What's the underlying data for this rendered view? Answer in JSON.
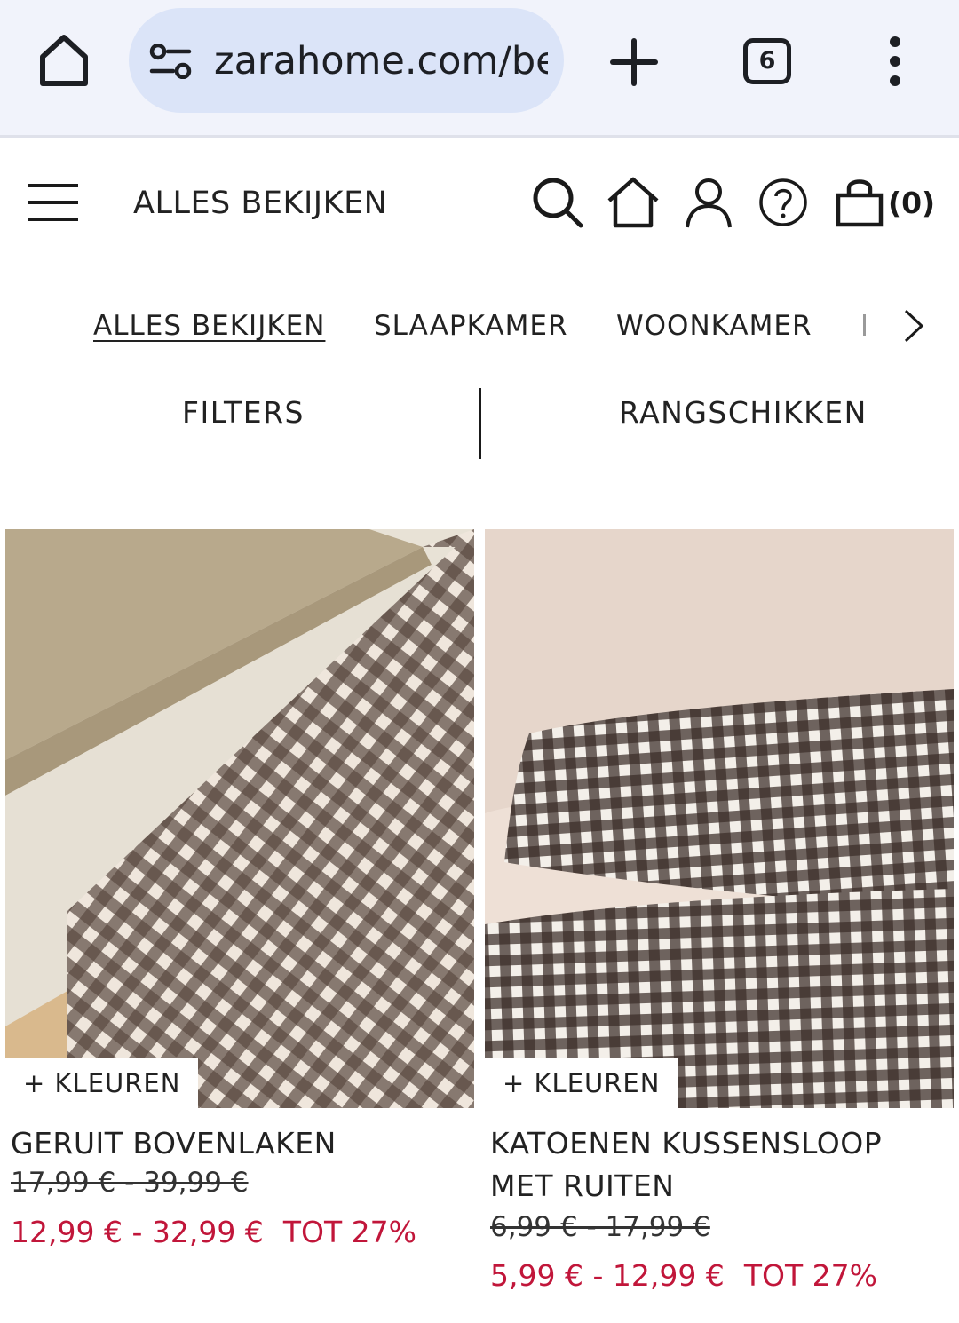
{
  "browser": {
    "url": "zarahome.com/be",
    "tab_count": "6"
  },
  "header": {
    "title": "ALLES BEKIJKEN",
    "cart_count": "(0)"
  },
  "categories": [
    {
      "label": "ALLES BEKIJKEN",
      "active": true
    },
    {
      "label": "SLAAPKAMER",
      "active": false
    },
    {
      "label": "WOONKAMER",
      "active": false
    }
  ],
  "toolbar": {
    "filters_label": "FILTERS",
    "sort_label": "RANGSCHIKKEN"
  },
  "products": [
    {
      "colors_label": "+ KLEUREN",
      "name": "GERUIT BOVENLAKEN",
      "old_price": "17,99 € - 39,99 €",
      "new_price": "12,99 € - 32,99 €",
      "discount": "TOT 27%"
    },
    {
      "colors_label": "+ KLEUREN",
      "name": "KATOENEN KUSSENSLOOP MET RUITEN",
      "old_price": "6,99 € - 17,99 €",
      "new_price": "5,99 € - 12,99 €",
      "discount": "TOT 27%"
    }
  ],
  "colors": {
    "sale_red": "#c1163a",
    "gingham_dark": "#4a3a33",
    "url_bar": "#dbe4f8"
  }
}
